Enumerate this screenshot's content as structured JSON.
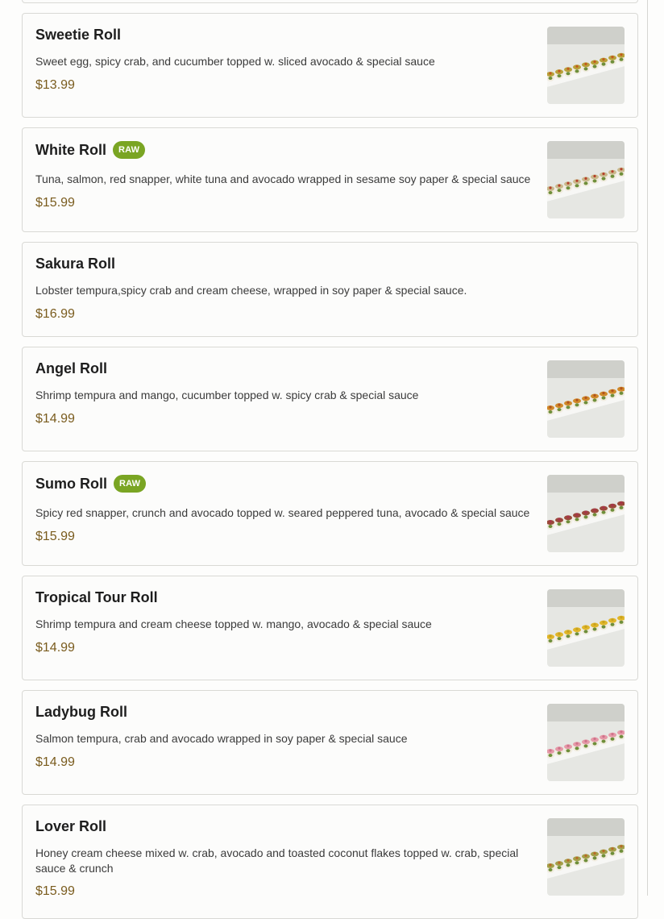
{
  "menu": {
    "items": [
      {
        "name": "Sweetie Roll",
        "badge": "",
        "description": "Sweet egg, spicy crab, and cucumber topped w. sliced avocado & special sauce",
        "price": "$13.99",
        "photo": true,
        "sauce": "#c25a1d",
        "topping": "#b8a13a"
      },
      {
        "name": "White Roll",
        "badge": "RAW",
        "description": "Tuna, salmon, red snapper, white tuna and avocado wrapped in sesame soy paper & special sauce",
        "price": "$15.99",
        "photo": true,
        "sauce": "#b5402a",
        "topping": "#c9b98c"
      },
      {
        "name": "Sakura Roll",
        "badge": "",
        "description": "Lobster tempura,spicy crab and cream cheese, wrapped in soy paper & special sauce.",
        "price": "$16.99",
        "photo": false
      },
      {
        "name": "Angel Roll",
        "badge": "",
        "description": "Shrimp tempura and mango, cucumber topped w. spicy crab & special sauce",
        "price": "$14.99",
        "photo": true,
        "sauce": "#b2521d",
        "topping": "#d08a2a"
      },
      {
        "name": "Sumo Roll",
        "badge": "RAW",
        "description": "Spicy red snapper, crunch and avocado topped w. seared peppered tuna, avocado & special sauce",
        "price": "$15.99",
        "photo": true,
        "sauce": "#a8334a",
        "topping": "#9a4a3a"
      },
      {
        "name": "Tropical Tour Roll",
        "badge": "",
        "description": "Shrimp tempura and cream cheese topped w. mango, avocado & special sauce",
        "price": "$14.99",
        "photo": true,
        "sauce": "#c9a21e",
        "topping": "#e0b62a"
      },
      {
        "name": "Ladybug Roll",
        "badge": "",
        "description": "Salmon tempura, crab and avocado wrapped in soy paper & special sauce",
        "price": "$14.99",
        "photo": true,
        "sauce": "#d0728a",
        "topping": "#e59aa8"
      },
      {
        "name": "Lover Roll",
        "badge": "",
        "description": "Honey cream cheese mixed w. crab, avocado and toasted coconut flakes topped w. crab, special sauce & crunch",
        "price": "$15.99",
        "photo": true,
        "sauce": "#b86a28",
        "topping": "#a3a04a"
      }
    ]
  }
}
